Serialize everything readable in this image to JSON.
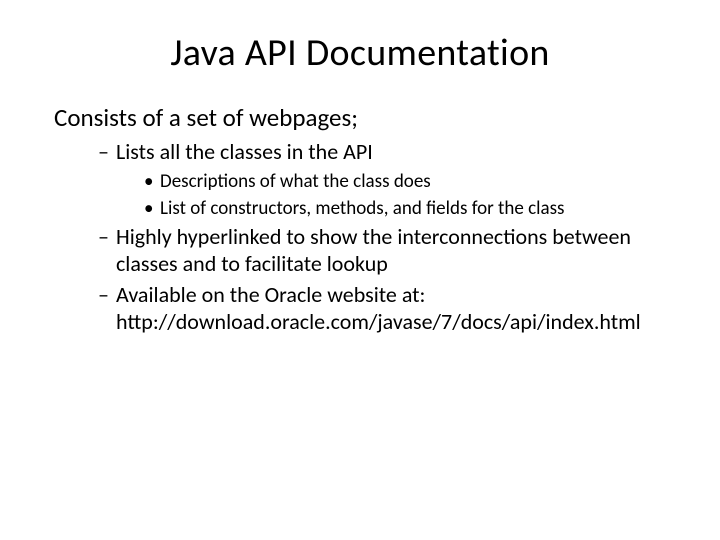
{
  "title": "Java API Documentation",
  "intro": "Consists of a set of webpages;",
  "bullets": {
    "b0": "Lists all the classes in the API",
    "b0_sub0": "Descriptions of what the class does",
    "b0_sub1": "List of constructors, methods, and fields for the class",
    "b1": "Highly hyperlinked to show the interconnections between classes and to facilitate lookup",
    "b2": "Available on the Oracle website at: http://download.oracle.com/javase/7/docs/api/index.html"
  }
}
